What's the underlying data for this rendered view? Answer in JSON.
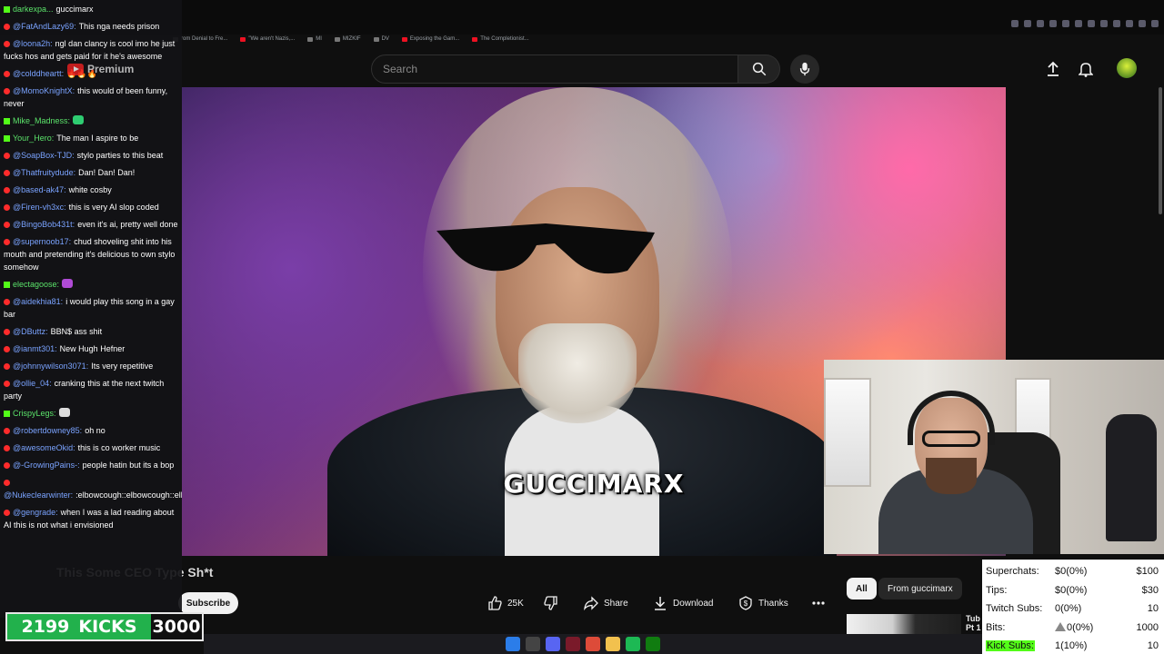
{
  "header": {
    "search_placeholder": "Search"
  },
  "bookmarks": [
    {
      "label": "rom Denial to Fre...",
      "icon": "grey"
    },
    {
      "label": "\"We aren't Nazis,...",
      "icon": "red"
    },
    {
      "label": "MI",
      "icon": "grey"
    },
    {
      "label": "MIZKIF",
      "icon": "grey"
    },
    {
      "label": "DV",
      "icon": "grey"
    },
    {
      "label": "Exposing the Gam...",
      "icon": "red"
    },
    {
      "label": "The Completionist...",
      "icon": "red"
    }
  ],
  "premium_label": "Premium",
  "video": {
    "caption": "GUCCIMARX",
    "title": "This Some CEO Type Sh*t"
  },
  "actions": {
    "likes": "25K",
    "share": "Share",
    "download": "Download",
    "thanks": "Thanks",
    "subscribe": "Subscribe"
  },
  "filters": {
    "all": "All",
    "from_channel": "From guccimarx"
  },
  "suggestion": {
    "title_line1": "Tub",
    "title_line2": "Pt 1"
  },
  "chat": [
    {
      "platform": "kick",
      "user": "darkexpa...",
      "user_green": true,
      "text": "guccimarx"
    },
    {
      "platform": "yt",
      "user": "@FatAndLazy69:",
      "text": "This nga needs prison"
    },
    {
      "platform": "yt",
      "user": "@loona2h:",
      "text": "ngl dan clancy is cool imo he just fucks hos and gets paid for it he's awesome"
    },
    {
      "platform": "yt",
      "user": "@colddheartt:",
      "text": "🔥🔥🔥"
    },
    {
      "platform": "yt",
      "user": "@MomoKnightX:",
      "text": "this would of been funny, never"
    },
    {
      "platform": "kick",
      "user": "Mike_Madness:",
      "user_green": true,
      "text": ""
    },
    {
      "platform": "kick",
      "user": "Your_Hero:",
      "user_green": true,
      "text": "The man I aspire to be"
    },
    {
      "platform": "yt",
      "user": "@SoapBox-TJD:",
      "text": "stylo parties to this beat"
    },
    {
      "platform": "yt",
      "user": "@Thatfruitydude:",
      "text": "Dan! Dan! Dan!"
    },
    {
      "platform": "yt",
      "user": "@based-ak47:",
      "text": "white cosby"
    },
    {
      "platform": "yt",
      "user": "@Firen-vh3xc:",
      "text": "this is very AI slop coded"
    },
    {
      "platform": "yt",
      "user": "@BingoBob431t:",
      "text": "even it's ai, pretty well done"
    },
    {
      "platform": "yt",
      "user": "@supernoob17:",
      "text": "chud shoveling shit into his mouth and pretending it's delicious to own stylo somehow"
    },
    {
      "platform": "kick",
      "user": "electagoose:",
      "user_green": true,
      "text": ""
    },
    {
      "platform": "yt",
      "user": "@aidekhia81:",
      "text": "i would play this song in a gay bar"
    },
    {
      "platform": "yt",
      "user": "@DButtz:",
      "text": "BBN$ ass shit"
    },
    {
      "platform": "yt",
      "user": "@ianmt301:",
      "text": "New Hugh Hefner"
    },
    {
      "platform": "yt",
      "user": "@johnnywilson3071:",
      "text": "Its very repetitive"
    },
    {
      "platform": "yt",
      "user": "@ollie_04:",
      "text": "cranking this at the next twitch party"
    },
    {
      "platform": "kick",
      "user": "CrispyLegs:",
      "user_green": true,
      "text": ""
    },
    {
      "platform": "yt",
      "user": "@robertdowney85:",
      "text": "oh no"
    },
    {
      "platform": "yt",
      "user": "@awesomeOkid:",
      "text": "this is co worker music"
    },
    {
      "platform": "yt",
      "user": "@-GrowingPains-:",
      "text": "people hatin but its a bop"
    },
    {
      "platform": "yt",
      "user": "@Nukeclearwinter:",
      "text": ":elbowcough::elbowcough::elbowcough::elbowcough:"
    },
    {
      "platform": "yt",
      "user": "@gengrade:",
      "text": "when I was a lad reading about AI this is not what i envisioned"
    }
  ],
  "kicks_counter": {
    "count": "2199",
    "label": "KICKS",
    "goal": "3000"
  },
  "stats": [
    {
      "label": "Superchats:",
      "value": "$0(0%)",
      "goal": "$100"
    },
    {
      "label": "Tips:",
      "value": "$0(0%)",
      "goal": "$30"
    },
    {
      "label": "Twitch Subs:",
      "value": "0(0%)",
      "goal": "10"
    },
    {
      "label": "Bits:",
      "value": "0(0%)",
      "goal": "1000"
    },
    {
      "label": "Kick Subs:",
      "value": "1(10%)",
      "goal": "10"
    }
  ]
}
